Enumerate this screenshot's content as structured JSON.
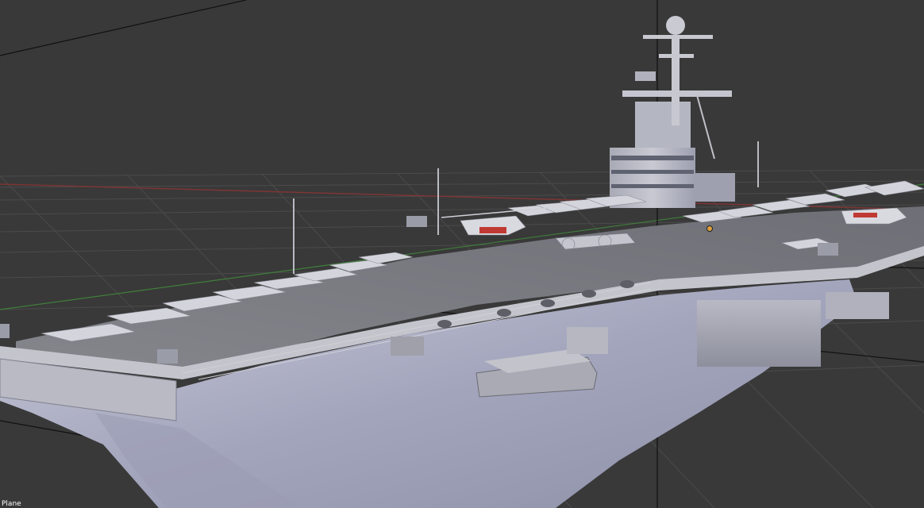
{
  "viewport": {
    "active_object_label": "Plane"
  },
  "colors": {
    "background": "#393939",
    "grid": "#4a4a4a",
    "x_axis": "#8a3a3a",
    "y_axis": "#4a8a3a",
    "hull": "#a9abbd",
    "deck": "#7f8088",
    "island": "#b6b8c2"
  },
  "icons": {
    "object_origin": "origin-dot-icon"
  }
}
